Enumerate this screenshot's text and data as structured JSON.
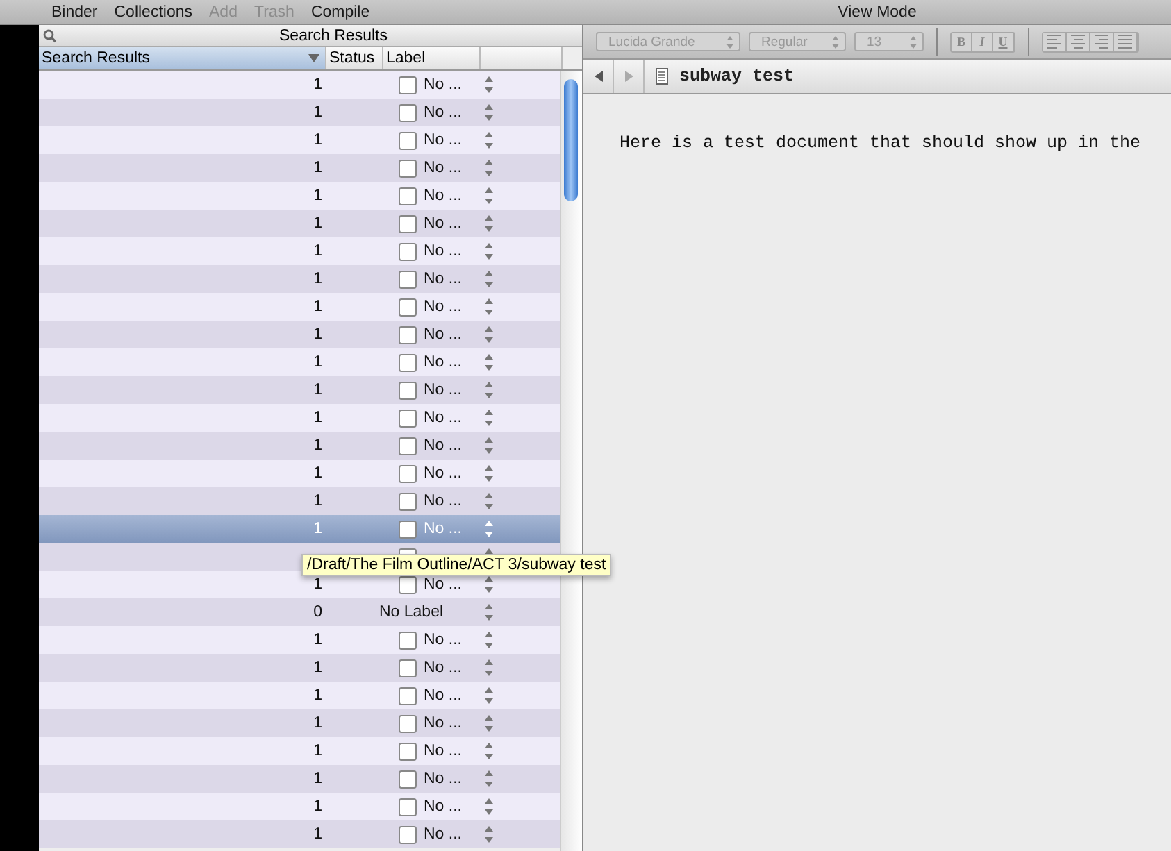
{
  "toolbar": {
    "items": [
      {
        "label": "Binder",
        "disabled": false
      },
      {
        "label": "Collections",
        "disabled": false
      },
      {
        "label": "Add",
        "disabled": true
      },
      {
        "label": "Trash",
        "disabled": true
      },
      {
        "label": "Compile",
        "disabled": false
      }
    ],
    "view_mode": "View Mode"
  },
  "binder": {
    "title": "Search Results",
    "columns": [
      "Search Results",
      "Status",
      "Label"
    ],
    "rows": [
      {
        "status": "1",
        "label": "No ...",
        "kind": "checkbox",
        "checked": false,
        "selected": false
      },
      {
        "status": "1",
        "label": "No ...",
        "kind": "checkbox",
        "checked": false,
        "selected": false
      },
      {
        "status": "1",
        "label": "No ...",
        "kind": "checkbox",
        "checked": false,
        "selected": false
      },
      {
        "status": "1",
        "label": "No ...",
        "kind": "checkbox",
        "checked": false,
        "selected": false
      },
      {
        "status": "1",
        "label": "No ...",
        "kind": "checkbox",
        "checked": false,
        "selected": false
      },
      {
        "status": "1",
        "label": "No ...",
        "kind": "checkbox",
        "checked": false,
        "selected": false
      },
      {
        "status": "1",
        "label": "No ...",
        "kind": "checkbox",
        "checked": false,
        "selected": false
      },
      {
        "status": "1",
        "label": "No ...",
        "kind": "checkbox",
        "checked": false,
        "selected": false
      },
      {
        "status": "1",
        "label": "No ...",
        "kind": "checkbox",
        "checked": false,
        "selected": false
      },
      {
        "status": "1",
        "label": "No ...",
        "kind": "checkbox",
        "checked": false,
        "selected": false
      },
      {
        "status": "1",
        "label": "No ...",
        "kind": "checkbox",
        "checked": false,
        "selected": false
      },
      {
        "status": "1",
        "label": "No ...",
        "kind": "checkbox",
        "checked": false,
        "selected": false
      },
      {
        "status": "1",
        "label": "No ...",
        "kind": "checkbox",
        "checked": false,
        "selected": false
      },
      {
        "status": "1",
        "label": "No ...",
        "kind": "checkbox",
        "checked": false,
        "selected": false
      },
      {
        "status": "1",
        "label": "No ...",
        "kind": "checkbox",
        "checked": false,
        "selected": false
      },
      {
        "status": "1",
        "label": "No ...",
        "kind": "checkbox",
        "checked": false,
        "selected": false
      },
      {
        "status": "1",
        "label": "No ...",
        "kind": "checkbox",
        "checked": false,
        "selected": true
      },
      {
        "kind": "covered",
        "selected": false
      },
      {
        "status": "1",
        "label": "No ...",
        "kind": "checkbox",
        "checked": false,
        "selected": false
      },
      {
        "status": "0",
        "label": "No Label",
        "kind": "plain",
        "selected": false
      },
      {
        "status": "1",
        "label": "No ...",
        "kind": "checkbox",
        "checked": false,
        "selected": false
      },
      {
        "status": "1",
        "label": "No ...",
        "kind": "checkbox",
        "checked": false,
        "selected": false
      },
      {
        "status": "1",
        "label": "No ...",
        "kind": "checkbox",
        "checked": false,
        "selected": false
      },
      {
        "status": "1",
        "label": "No ...",
        "kind": "checkbox",
        "checked": false,
        "selected": false
      },
      {
        "status": "1",
        "label": "No ...",
        "kind": "checkbox",
        "checked": false,
        "selected": false
      },
      {
        "status": "1",
        "label": "No ...",
        "kind": "checkbox",
        "checked": false,
        "selected": false
      },
      {
        "status": "1",
        "label": "No ...",
        "kind": "checkbox",
        "checked": false,
        "selected": false
      },
      {
        "status": "1",
        "label": "No ...",
        "kind": "checkbox",
        "checked": false,
        "selected": false
      }
    ],
    "tooltip": "/Draft/The Film Outline/ACT 3/subway test"
  },
  "format_bar": {
    "font": "Lucida Grande",
    "style": "Regular",
    "size": "13",
    "buttons": [
      "B",
      "I",
      "U"
    ]
  },
  "editor": {
    "title": "subway test",
    "text": "Here is a test document that should show up in the"
  }
}
